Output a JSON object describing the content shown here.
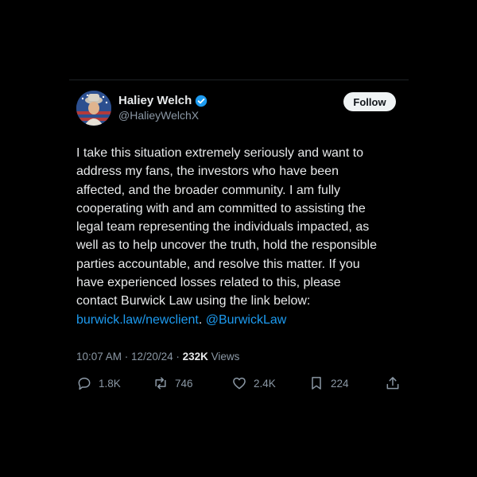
{
  "author": {
    "display_name": "Haliey Welch",
    "handle": "@HalieyWelchX",
    "verified": true
  },
  "follow_label": "Follow",
  "tweet": {
    "lines": [
      "I take this situation extremely seriously and want to",
      "address my fans, the investors who have been",
      "affected, and the broader community. I am fully",
      "cooperating with and am committed to assisting the",
      "legal team representing the individuals impacted, as",
      "well as to help uncover the truth, hold the responsible",
      "parties accountable, and resolve this matter. If you",
      "have experienced losses related to this, please",
      "contact Burwick Law using the link below:"
    ],
    "link_text": "burwick.law/newclient",
    "link_sep": ". ",
    "mention": "@BurwickLaw"
  },
  "meta": {
    "time": "10:07 AM",
    "dot1": " · ",
    "date": "12/20/24",
    "dot2": " · ",
    "views_count": "232K",
    "views_label": " Views"
  },
  "actions": {
    "replies": "1.8K",
    "reposts": "746",
    "likes": "2.4K",
    "bookmarks": "224"
  },
  "colors": {
    "accent": "#1d9bf0",
    "background": "#000000",
    "text": "#e7e9ea",
    "muted": "#8b98a5"
  },
  "icons": [
    "verified-badge-icon",
    "reply-icon",
    "repost-icon",
    "like-icon",
    "bookmark-icon",
    "share-icon"
  ]
}
